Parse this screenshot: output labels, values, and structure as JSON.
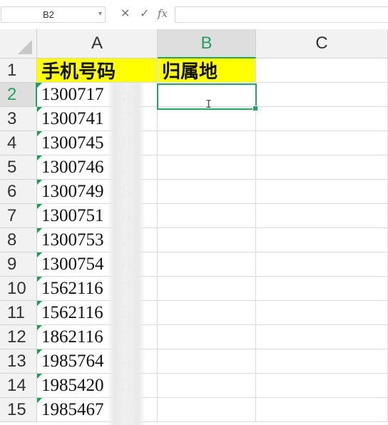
{
  "formula_bar": {
    "name_box": "B2",
    "cancel_icon": "✕",
    "confirm_icon": "✓",
    "fx_label": "fx",
    "formula": ""
  },
  "columns": [
    "A",
    "B",
    "C"
  ],
  "active_column": "B",
  "active_row": "2",
  "rows": [
    "1",
    "2",
    "3",
    "4",
    "5",
    "6",
    "7",
    "8",
    "9",
    "10",
    "11",
    "12",
    "13",
    "14",
    "15"
  ],
  "header_row": {
    "A": "手机号码",
    "B": "归属地"
  },
  "phone_numbers": [
    "1300717    5",
    "1300741    7",
    "1300745    8",
    "1300746    3",
    "1300749    5",
    "1300751    8",
    "1300753    2",
    "1300754    8",
    "1562116    7",
    "1562116    5",
    "1862116    7",
    "1985764    4",
    "1985420    3",
    "1985467    1"
  ],
  "header_fill": "#ffff00",
  "accent": "#21a366"
}
